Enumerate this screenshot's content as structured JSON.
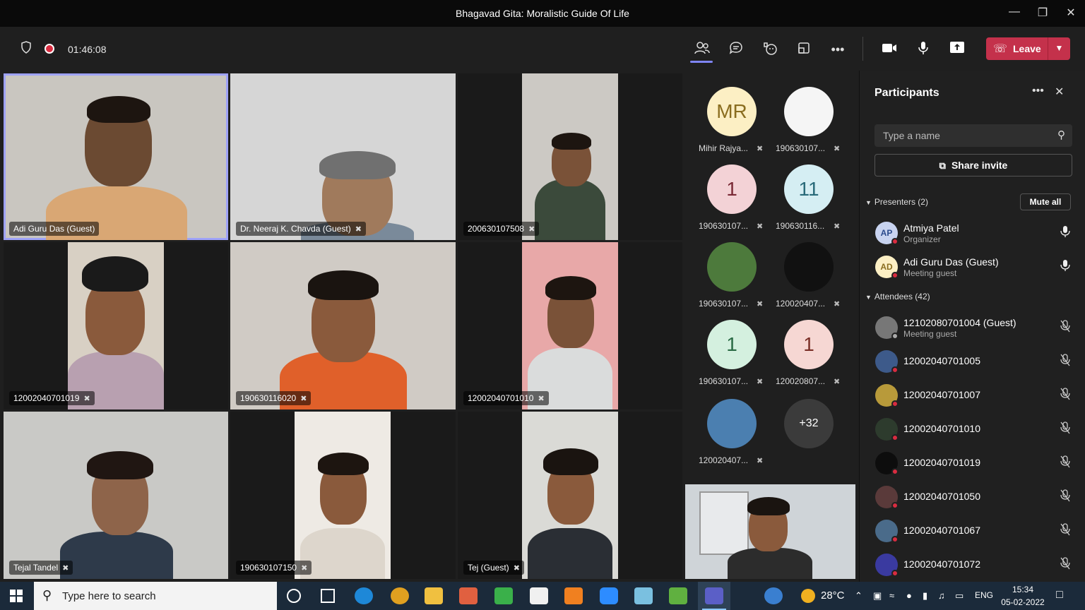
{
  "window": {
    "title": "Bhagavad Gita: Moralistic Guide Of Life"
  },
  "toolbar": {
    "timer": "01:46:08",
    "leave_label": "Leave",
    "icons": [
      "shield-icon",
      "record-icon",
      "people-icon",
      "chat-icon",
      "reactions-icon",
      "rooms-icon",
      "more-icon",
      "camera-icon",
      "mic-icon",
      "share-icon"
    ]
  },
  "tiles": [
    {
      "name": "Adi Guru Das (Guest)",
      "muted": false
    },
    {
      "name": "Dr. Neeraj K. Chavda (Guest)",
      "muted": true
    },
    {
      "name": "200630107508",
      "muted": true
    },
    {
      "name": "12002040701019",
      "muted": true
    },
    {
      "name": "190630116020",
      "muted": true
    },
    {
      "name": "12002040701010",
      "muted": true
    },
    {
      "name": "Tejal Tandel",
      "muted": true
    },
    {
      "name": "190630107150",
      "muted": true
    },
    {
      "name": "Tej (Guest)",
      "muted": true
    }
  ],
  "avatars": [
    {
      "initials": "MR",
      "label": "Mihir Rajya...",
      "bg": "#fcefc4",
      "fg": "#8a6d1f"
    },
    {
      "initials": "",
      "label": "190630107...",
      "bg": "#f5f5f5",
      "fg": "#333"
    },
    {
      "initials": "1",
      "label": "190630107...",
      "bg": "#f3d2d6",
      "fg": "#7a2a36"
    },
    {
      "initials": "11",
      "label": "190630116...",
      "bg": "#d5eef3",
      "fg": "#2a6b7a"
    },
    {
      "initials": "",
      "label": "190630107...",
      "bg": "#4d7a3c",
      "fg": "#fff"
    },
    {
      "initials": "",
      "label": "120020407...",
      "bg": "#111111",
      "fg": "#fff"
    },
    {
      "initials": "1",
      "label": "190630107...",
      "bg": "#d4f0df",
      "fg": "#2a6b45"
    },
    {
      "initials": "1",
      "label": "120020807...",
      "bg": "#f6d7d3",
      "fg": "#7a2f27"
    },
    {
      "initials": "",
      "label": "120020407...",
      "bg": "#4b7fb0",
      "fg": "#fff"
    },
    {
      "initials": "+32",
      "label": "",
      "bg": "#3b3b3b",
      "fg": "#fff"
    }
  ],
  "panel": {
    "title": "Participants",
    "search_placeholder": "Type a name",
    "share_invite": "Share invite",
    "presenters_header": "Presenters (2)",
    "mute_all": "Mute all",
    "attendees_header": "Attendees (42)",
    "presenters": [
      {
        "initials": "AP",
        "name": "Atmiya Patel",
        "role": "Organizer",
        "bg": "#c8d3f0",
        "fg": "#2b4a8c"
      },
      {
        "initials": "AD",
        "name": "Adi Guru Das (Guest)",
        "role": "Meeting guest",
        "bg": "#fcefc4",
        "fg": "#8a6d1f"
      }
    ],
    "attendees": [
      {
        "initials": "",
        "name": "12102080701004 (Guest)",
        "role": "Meeting guest",
        "bg": "#777"
      },
      {
        "initials": "",
        "name": "12002040701005",
        "role": "",
        "bg": "#3d5a8a"
      },
      {
        "initials": "",
        "name": "12002040701007",
        "role": "",
        "bg": "#b89a3a"
      },
      {
        "initials": "",
        "name": "12002040701010",
        "role": "",
        "bg": "#2d3b2d"
      },
      {
        "initials": "",
        "name": "12002040701019",
        "role": "",
        "bg": "#0d0d0d"
      },
      {
        "initials": "",
        "name": "12002040701050",
        "role": "",
        "bg": "#5a3a3a"
      },
      {
        "initials": "",
        "name": "12002040701067",
        "role": "",
        "bg": "#4a6b8a"
      },
      {
        "initials": "",
        "name": "12002040701072",
        "role": "",
        "bg": "#3a3aa0"
      }
    ]
  },
  "taskbar": {
    "search_placeholder": "Type here to search",
    "weather": "28°C",
    "lang": "ENG",
    "time": "15:34",
    "date": "05-02-2022"
  },
  "colors": {
    "leave": "#c4314b",
    "accent": "#7f85f5",
    "status_busy": "#d92c40"
  }
}
